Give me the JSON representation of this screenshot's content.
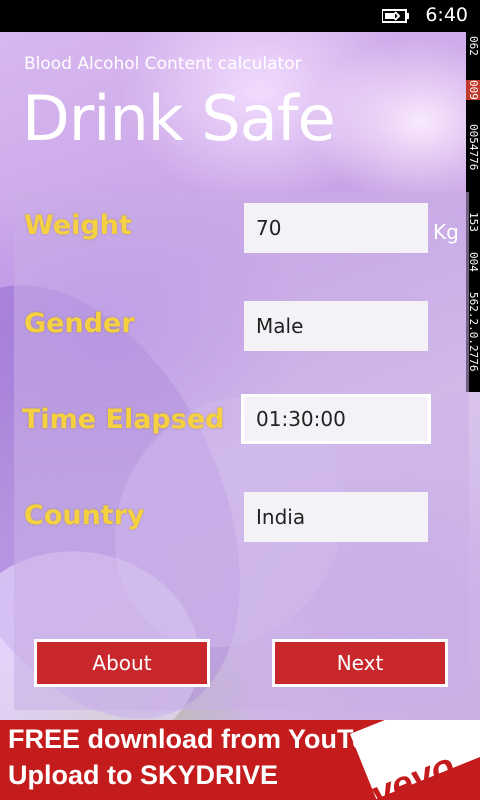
{
  "status_bar": {
    "time": "6:40"
  },
  "header": {
    "subtitle": "Blood Alcohol Content calculator",
    "title": "Drink Safe"
  },
  "form": {
    "weight": {
      "label": "Weight",
      "value": "70",
      "unit": "Kg"
    },
    "gender": {
      "label": "Gender",
      "value": "Male"
    },
    "time_elapsed": {
      "label": "Time Elapsed",
      "value": "01:30:00"
    },
    "country": {
      "label": "Country",
      "value": "India"
    }
  },
  "buttons": {
    "about": "About",
    "next": "Next"
  },
  "debug_counters": [
    "062",
    "009",
    "0054776",
    "153",
    "004",
    "562.2.0.2776"
  ],
  "ad": {
    "line1": "FREE download from YouTube",
    "line2": "Upload to SKYDRIVE",
    "brand": "vevo"
  },
  "colors": {
    "label": "#f5d040",
    "button": "#c8282b",
    "ad_bg": "#c41c1c"
  }
}
